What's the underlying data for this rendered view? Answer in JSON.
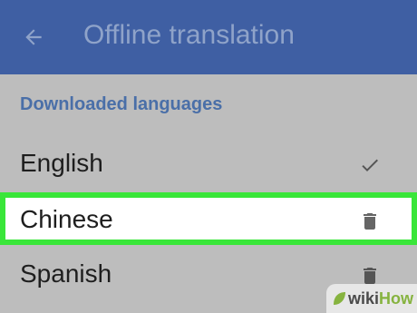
{
  "appbar": {
    "title": "Offline translation",
    "back_icon": "arrow-back-icon",
    "background_color": "#3f5fa3"
  },
  "section": {
    "header": "Downloaded languages"
  },
  "languages": [
    {
      "name": "English",
      "icon": "checkmark-icon",
      "selected": false
    },
    {
      "name": "Chinese",
      "icon": "trash-icon",
      "selected": true
    },
    {
      "name": "Spanish",
      "icon": "trash-icon",
      "selected": false
    }
  ],
  "highlight_color": "#39e639",
  "watermark": {
    "prefix": "wiki",
    "suffix": "How"
  }
}
